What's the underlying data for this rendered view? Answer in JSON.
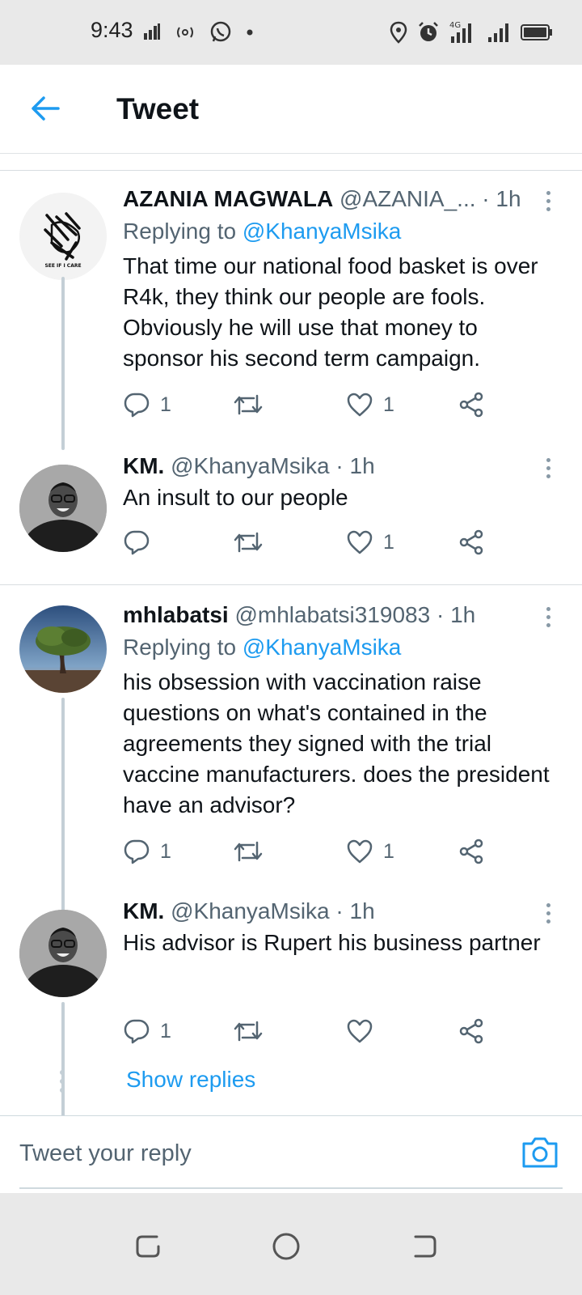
{
  "status_bar": {
    "time": "9:43",
    "left_icons": [
      "data-icon",
      "nfc-icon",
      "whatsapp-icon",
      "dot-icon"
    ],
    "right_icons": [
      "location-icon",
      "alarm-icon",
      "signal-4g-icon",
      "signal-icon",
      "battery-icon"
    ],
    "network_label": "4G"
  },
  "header": {
    "title": "Tweet",
    "back_icon": "arrow-left-icon",
    "accent": "#1d9bf0"
  },
  "tweets": [
    {
      "name": "AZANIA MAGWALA",
      "handle": "@AZANIA_...",
      "time": "1h",
      "replying_prefix": "Replying to",
      "replying_to": "@KhanyaMsika",
      "text": "That time our national food basket is over R4k, they think our people are fools. Obviously he will use that money to sponsor his second term campaign.",
      "avatar_caption": "SEE IF I CARE",
      "replies": "1",
      "retweets": "",
      "likes": "1"
    },
    {
      "name": "KM.",
      "handle": "@KhanyaMsika",
      "time": "1h",
      "text": "An insult to our people",
      "replies": "",
      "retweets": "",
      "likes": "1"
    },
    {
      "name": "mhlabatsi",
      "handle": "@mhlabatsi319083",
      "time": "1h",
      "replying_prefix": "Replying to",
      "replying_to": "@KhanyaMsika",
      "text": "his obsession with vaccination raise questions on what's contained in the agreements they signed with the trial vaccine manufacturers. does the president have an advisor?",
      "replies": "1",
      "retweets": "",
      "likes": "1"
    },
    {
      "name": "KM.",
      "handle": "@KhanyaMsika",
      "time": "1h",
      "text": "His advisor is Rupert his business partner",
      "replies": "1",
      "retweets": "",
      "likes": ""
    }
  ],
  "separator": "·",
  "show_replies": "Show replies",
  "composer": {
    "placeholder": "Tweet your reply",
    "camera_icon": "camera-icon"
  },
  "nav_bar": {
    "buttons": [
      "recent-apps-icon",
      "home-icon",
      "back-icon"
    ]
  }
}
